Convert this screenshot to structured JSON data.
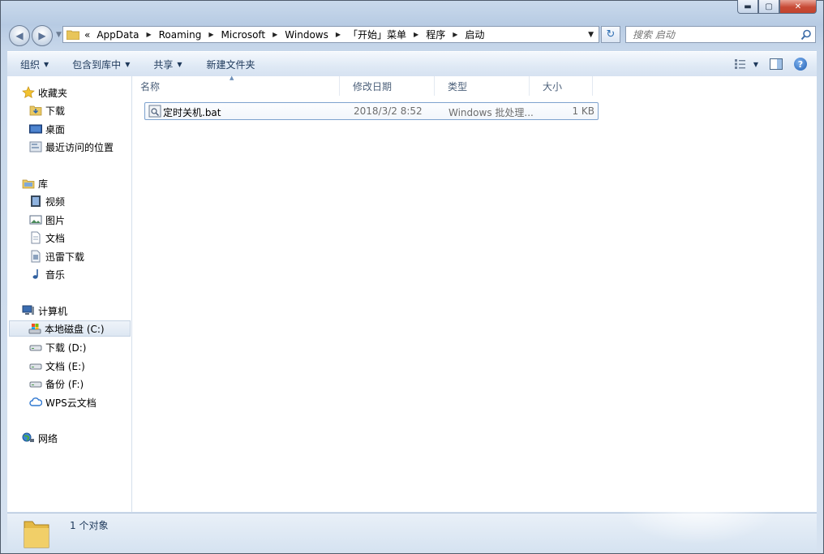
{
  "address": {
    "overflow": "«",
    "crumbs": [
      "AppData",
      "Roaming",
      "Microsoft",
      "Windows",
      "「开始」菜单",
      "程序",
      "启动"
    ]
  },
  "search": {
    "placeholder": "搜索 启动"
  },
  "toolbar": {
    "organize": "组织",
    "include_in_library": "包含到库中",
    "share": "共享",
    "new_folder": "新建文件夹"
  },
  "nav": {
    "favorites": "收藏夹",
    "fav_items": [
      "下载",
      "桌面",
      "最近访问的位置"
    ],
    "libraries": "库",
    "lib_items": [
      "视频",
      "图片",
      "文档",
      "迅雷下载",
      "音乐"
    ],
    "computer": "计算机",
    "drives": [
      "本地磁盘 (C:)",
      "下载 (D:)",
      "文档 (E:)",
      "备份 (F:)",
      "WPS云文档"
    ],
    "network": "网络"
  },
  "columns": {
    "name": "名称",
    "modified": "修改日期",
    "type": "类型",
    "size": "大小"
  },
  "files": [
    {
      "name": "定时关机.bat",
      "modified": "2018/3/2 8:52",
      "type": "Windows 批处理...",
      "size": "1 KB"
    }
  ],
  "status": {
    "count": "1 个对象"
  },
  "colors": {
    "accent": "#1e395b",
    "selection_border": "#7da2ce",
    "close_button": "#c74a36"
  },
  "icons": [
    "back-icon",
    "forward-icon",
    "folder-icon",
    "refresh-icon",
    "search-icon",
    "star-icon",
    "drive-icon",
    "cloud-icon",
    "network-icon",
    "help-icon"
  ]
}
